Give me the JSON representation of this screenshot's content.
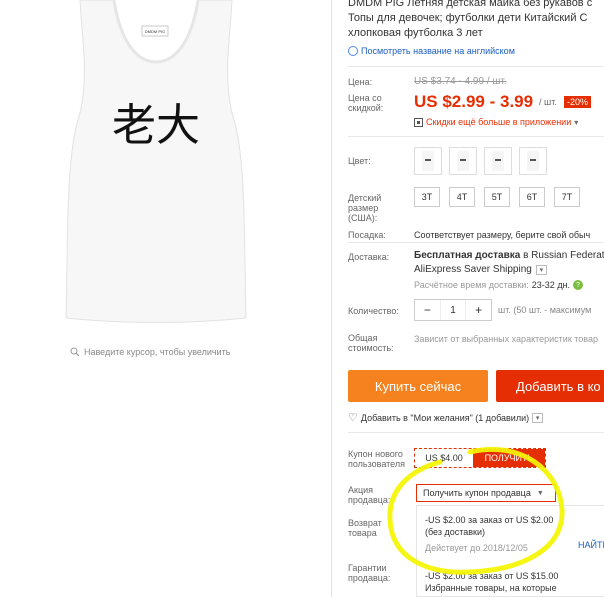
{
  "product": {
    "title_line1": "DMDM PIG Летняя детская майка без рукавов с",
    "title_line2": "Топы для девочек; футболки дети Китайский С",
    "title_line3": "хлопковая футболка 3 лет",
    "translate_link": "Посмотреть название на английском",
    "image_print_text": "老大",
    "tag_text": "DMDM PIG",
    "zoom_hint": "Наведите курсор, чтобы увеличить"
  },
  "price": {
    "label_price": "Цена:",
    "old_price": "US $3.74 - 4.99 / шт.",
    "label_discount_line1": "Цена со",
    "label_discount_line2": "скидкой:",
    "current_price": "US $2.99 - 3.99",
    "per_unit": "/ шт.",
    "discount_badge": "-20%",
    "app_promo": "Скидки ещё больше в приложении",
    "app_promo_caret": "▾"
  },
  "options": {
    "color_label": "Цвет:",
    "size_label_line1": "Детский",
    "size_label_line2": "размер",
    "size_label_line3": "(США):",
    "sizes": [
      "3T",
      "4T",
      "5T",
      "6T",
      "7T"
    ],
    "fit_label": "Посадка:",
    "fit_value": "Соответствует размеру, берите свой обыч"
  },
  "shipping": {
    "label": "Доставка:",
    "free_bold": "Бесплатная доставка",
    "to_country": " в Russian Federatio",
    "method": "AliExpress Saver Shipping",
    "time_label": "Расчётное время доставки:",
    "time_value": "23-32 дн.",
    "help": "?"
  },
  "quantity": {
    "label": "Количество:",
    "minus": "−",
    "value": "1",
    "plus": "+",
    "note": "шт. (50 шт. - максимум"
  },
  "total": {
    "label_line1": "Общая",
    "label_line2": "стоимость:",
    "value": "Зависит от выбранных характеристик товар"
  },
  "actions": {
    "buy_now": "Купить сейчас",
    "add_to_cart": "Добавить в ко",
    "wishlist": "Добавить в \"Мои желания\" (1 добавили)",
    "wishlist_caret": "▾"
  },
  "coupons": {
    "new_user_label_line1": "Купон нового",
    "new_user_label_line2": "пользователя",
    "new_user_amount": "US $4.00",
    "get_button": "ПОЛУЧИТЬ",
    "seller_promo_label_line1": "Акция",
    "seller_promo_label_line2": "продавца:",
    "seller_coupon_select": "Получить купон продавца",
    "coupon1_line1": "-US $2.00 за заказ от US $2.00",
    "coupon1_line2": "(без доставки)",
    "coupon1_valid": "Действует до 2018/12/05",
    "coupon2_line1": "-US $2.00 за заказ от US $15.00",
    "coupon2_line2": "Избранные товары, на которые",
    "get_link": "НАЙТИ"
  },
  "return_label_line1": "Возврат",
  "return_label_line2": "товара",
  "guarantee_label_line1": "Гарантии",
  "guarantee_label_line2": "продавца:",
  "colors": {
    "price_red": "#e62e04",
    "buy_orange": "#f5821f",
    "link_blue": "#1d5ec2",
    "highlight_yellow": "#f5f500"
  }
}
